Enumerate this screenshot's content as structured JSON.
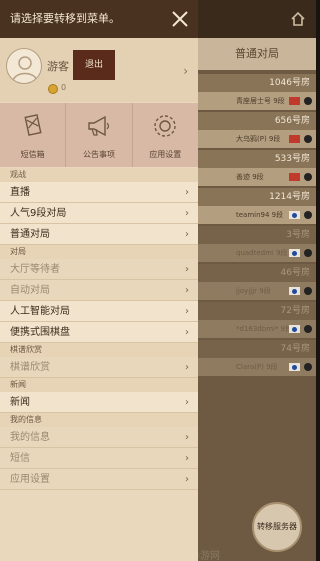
{
  "drawer": {
    "title": "请选择要转移到菜单。",
    "user": {
      "name": "游客",
      "logout_label": "退出",
      "coins": "0"
    },
    "quick_icons": [
      {
        "label": "短信箱",
        "icon": "mailbox-icon"
      },
      {
        "label": "公告事项",
        "icon": "megaphone-icon"
      },
      {
        "label": "应用设置",
        "icon": "gear-icon"
      }
    ],
    "sections": [
      {
        "title": "观战",
        "items": [
          {
            "label": "直播",
            "dim": false
          },
          {
            "label": "人气9段对局",
            "dim": false
          },
          {
            "label": "普通对局",
            "dim": false
          }
        ]
      },
      {
        "title": "对局",
        "items": [
          {
            "label": "大厅等待者",
            "dim": true
          },
          {
            "label": "自动对局",
            "dim": true
          },
          {
            "label": "人工智能对局",
            "dim": false
          },
          {
            "label": "便携式围棋盘",
            "dim": false
          }
        ]
      },
      {
        "title": "棋谱欣赏",
        "items": [
          {
            "label": "棋谱欣赏",
            "dim": true
          }
        ]
      },
      {
        "title": "新闻",
        "items": [
          {
            "label": "新闻",
            "dim": false
          }
        ]
      },
      {
        "title": "我的信息",
        "items": [
          {
            "label": "我的信息",
            "dim": true
          },
          {
            "label": "短信",
            "dim": true
          },
          {
            "label": "应用设置",
            "dim": true
          }
        ]
      }
    ]
  },
  "background": {
    "tab_label": "普通对局",
    "rooms": [
      {
        "room": "1046号房",
        "player": "青座居士号 9段",
        "flag": "cn",
        "empty": false
      },
      {
        "room": "656号房",
        "player": "大乌鸦(P) 9段",
        "flag": "cn",
        "empty": false
      },
      {
        "room": "533号房",
        "player": "善迹 9段",
        "flag": "cn",
        "empty": false
      },
      {
        "room": "1214号房",
        "player": "teamin94 9段",
        "flag": "kr",
        "empty": false
      },
      {
        "room": "3号房",
        "player": "quadtedmi 9段",
        "flag": "kr",
        "empty": true
      },
      {
        "room": "46号房",
        "player": "jjoyjjjr 9段",
        "flag": "kr",
        "empty": true
      },
      {
        "room": "72号房",
        "player": "*d163dbmi* 9段",
        "flag": "kr",
        "empty": true
      },
      {
        "room": "74号房",
        "player": "Clara(P) 9段",
        "flag": "kr",
        "empty": true
      }
    ],
    "float_button_label": "转移服务器",
    "watermark": "天地手游网"
  },
  "colors": {
    "drawer_bg": "#ead8bd",
    "header_bg": "#4a3220",
    "logout_bg": "#5a2a1a"
  }
}
